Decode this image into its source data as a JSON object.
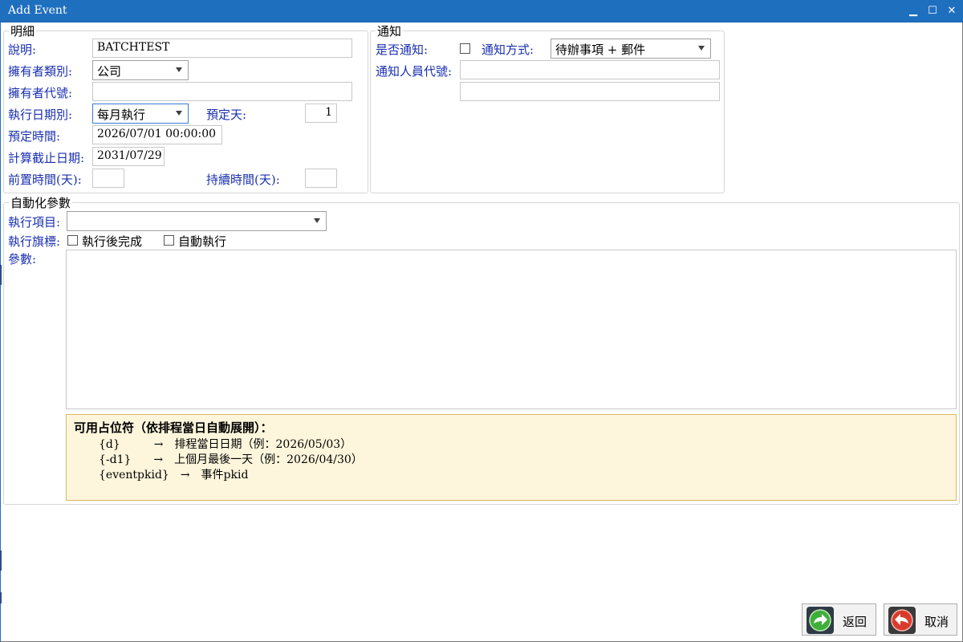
{
  "window": {
    "title": "Add Event",
    "minimize_glyph": "▁",
    "maximize_glyph": "☐",
    "close_glyph": "✕"
  },
  "details": {
    "legend": "明細",
    "description_label": "說明:",
    "description_value": "BATCHTEST",
    "owner_type_label": "擁有者類別:",
    "owner_type_value": "公司",
    "owner_id_label": "擁有者代號:",
    "owner_id_value": "",
    "exec_date_type_label": "執行日期別:",
    "exec_date_type_value": "每月執行",
    "scheduled_day_label": "預定天:",
    "scheduled_day_value": "1",
    "scheduled_time_label": "預定時間:",
    "scheduled_time_value": "2026/07/01 00:00:00",
    "calc_end_date_label": "計算截止日期:",
    "calc_end_date_value": "2031/07/29",
    "lead_time_label": "前置時間(天):",
    "lead_time_value": "",
    "duration_label": "持續時間(天):",
    "duration_value": ""
  },
  "notify": {
    "legend": "通知",
    "notify_label": "是否通知:",
    "method_label": "通知方式:",
    "method_value": "待辦事項 + 郵件",
    "recipient_label": "通知人員代號:",
    "recipient_value_1": "",
    "recipient_value_2": ""
  },
  "automation": {
    "legend": "自動化參數",
    "exec_item_label": "執行項目:",
    "exec_item_value": "",
    "exec_flags_label": "執行旗標:",
    "flag_complete_label": "執行後完成",
    "flag_auto_label": "自動執行",
    "params_label": "參數:",
    "params_value": ""
  },
  "hint": {
    "title": "可用占位符（依排程當日自動展開）：",
    "lines": [
      "{d}　　　→　排程當日日期（例：2026/05/03）",
      "{-d1}　　→　上個月最後一天（例：2026/04/30）",
      "{eventpkid}　→　事件pkid"
    ]
  },
  "buttons": {
    "back_label": "返回",
    "cancel_label": "取消"
  },
  "colors": {
    "titlebar": "#1f6fbf",
    "label_blue": "#1a2fb0",
    "hint_bg": "#fdf6dc",
    "hint_border": "#d9b860"
  }
}
